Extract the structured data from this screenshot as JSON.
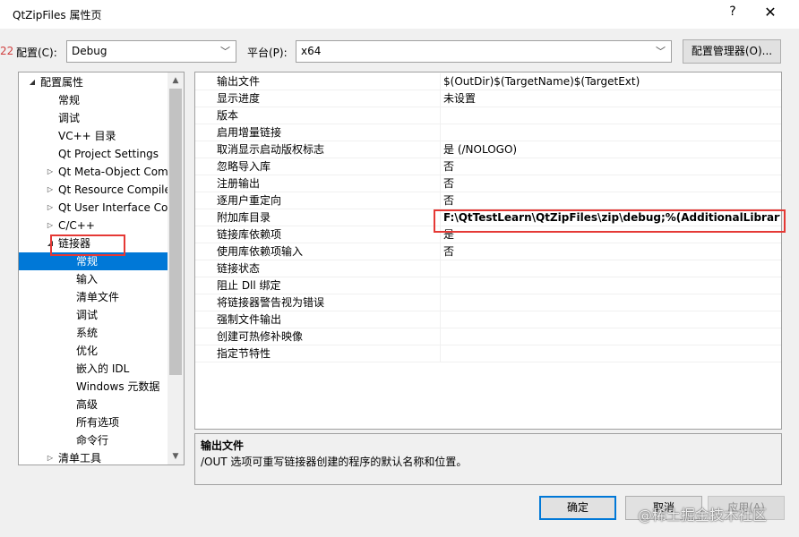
{
  "window": {
    "title": "QtZipFiles 属性页",
    "help": "?",
    "close": "✕"
  },
  "edge_mark": "22",
  "config": {
    "config_label": "配置(C):",
    "config_value": "Debug",
    "platform_label": "平台(P):",
    "platform_value": "x64",
    "manager_button": "配置管理器(O)..."
  },
  "tree": {
    "items": [
      {
        "label": "配置属性",
        "expander": "◢"
      },
      {
        "label": "常规",
        "expander": ""
      },
      {
        "label": "调试",
        "expander": ""
      },
      {
        "label": "VC++ 目录",
        "expander": ""
      },
      {
        "label": "Qt Project Settings",
        "expander": ""
      },
      {
        "label": "Qt Meta-Object Com",
        "expander": "▷"
      },
      {
        "label": "Qt Resource Compile",
        "expander": "▷"
      },
      {
        "label": "Qt User Interface Cor",
        "expander": "▷"
      },
      {
        "label": "C/C++",
        "expander": "▷"
      },
      {
        "label": "链接器",
        "expander": "◢"
      },
      {
        "label": "常规",
        "expander": ""
      },
      {
        "label": "输入",
        "expander": ""
      },
      {
        "label": "清单文件",
        "expander": ""
      },
      {
        "label": "调试",
        "expander": ""
      },
      {
        "label": "系统",
        "expander": ""
      },
      {
        "label": "优化",
        "expander": ""
      },
      {
        "label": "嵌入的 IDL",
        "expander": ""
      },
      {
        "label": "Windows 元数据",
        "expander": ""
      },
      {
        "label": "高级",
        "expander": ""
      },
      {
        "label": "所有选项",
        "expander": ""
      },
      {
        "label": "命令行",
        "expander": ""
      },
      {
        "label": "清单工具",
        "expander": "▷"
      }
    ],
    "scroll_up": "▲",
    "scroll_down": "▼"
  },
  "properties": [
    {
      "name": "输出文件",
      "value": "$(OutDir)$(TargetName)$(TargetExt)"
    },
    {
      "name": "显示进度",
      "value": "未设置"
    },
    {
      "name": "版本",
      "value": ""
    },
    {
      "name": "启用增量链接",
      "value": ""
    },
    {
      "name": "取消显示启动版权标志",
      "value": "是 (/NOLOGO)"
    },
    {
      "name": "忽略导入库",
      "value": "否"
    },
    {
      "name": "注册输出",
      "value": "否"
    },
    {
      "name": "逐用户重定向",
      "value": "否"
    },
    {
      "name": "附加库目录",
      "value": "F:\\QtTestLearn\\QtZipFiles\\zip\\debug;%(AdditionalLibraryDire"
    },
    {
      "name": "链接库依赖项",
      "value": "是"
    },
    {
      "name": "使用库依赖项输入",
      "value": "否"
    },
    {
      "name": "链接状态",
      "value": ""
    },
    {
      "name": "阻止 Dll 绑定",
      "value": ""
    },
    {
      "name": "将链接器警告视为错误",
      "value": ""
    },
    {
      "name": "强制文件输出",
      "value": ""
    },
    {
      "name": "创建可热修补映像",
      "value": ""
    },
    {
      "name": "指定节特性",
      "value": ""
    }
  ],
  "description": {
    "heading": "输出文件",
    "text": "/OUT 选项可重写链接器创建的程序的默认名称和位置。"
  },
  "buttons": {
    "ok": "确定",
    "cancel": "取消",
    "apply": "应用(A)"
  },
  "watermark": "@稀土掘金技术社区",
  "colors": {
    "selection": "#0078d7",
    "highlight_box": "#e53935"
  }
}
